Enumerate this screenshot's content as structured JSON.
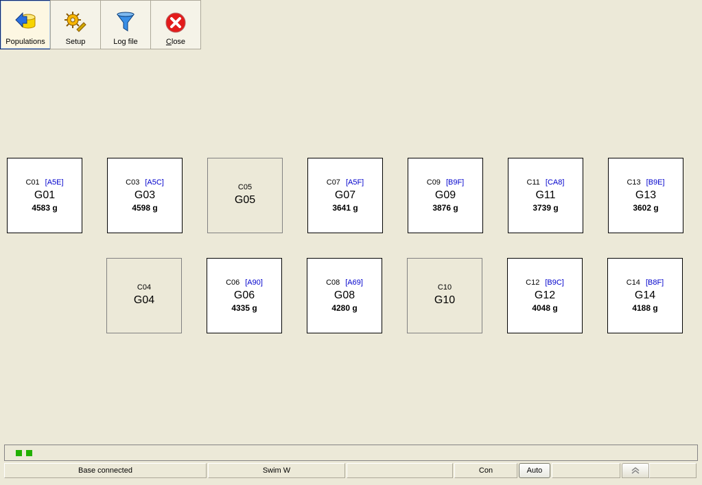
{
  "toolbar": {
    "populations": {
      "label": "Populations",
      "icon": "db-arrow"
    },
    "setup": {
      "label": "Setup",
      "icon": "gears"
    },
    "logfile": {
      "label": "Log file",
      "icon": "funnel"
    },
    "close": {
      "label": "Close",
      "mnemonic": "C",
      "icon": "close-x"
    }
  },
  "tiles": {
    "row1": [
      {
        "code": "C01",
        "hex": "[A5E]",
        "name": "G01",
        "weight": "4583 g",
        "active": true
      },
      {
        "code": "C03",
        "hex": "[A5C]",
        "name": "G03",
        "weight": "4598 g",
        "active": true
      },
      {
        "code": "C05",
        "hex": "",
        "name": "G05",
        "weight": "",
        "active": false
      },
      {
        "code": "C07",
        "hex": "[A5F]",
        "name": "G07",
        "weight": "3641 g",
        "active": true
      },
      {
        "code": "C09",
        "hex": "[B9F]",
        "name": "G09",
        "weight": "3876 g",
        "active": true
      },
      {
        "code": "C11",
        "hex": "[CA8]",
        "name": "G11",
        "weight": "3739 g",
        "active": true
      },
      {
        "code": "C13",
        "hex": "[B9E]",
        "name": "G13",
        "weight": "3602 g",
        "active": true
      }
    ],
    "row2": [
      {
        "code": "C04",
        "hex": "",
        "name": "G04",
        "weight": "",
        "active": false
      },
      {
        "code": "C06",
        "hex": "[A90]",
        "name": "G06",
        "weight": "4335 g",
        "active": true
      },
      {
        "code": "C08",
        "hex": "[A69]",
        "name": "G08",
        "weight": "4280 g",
        "active": true
      },
      {
        "code": "C10",
        "hex": "",
        "name": "G10",
        "weight": "",
        "active": false
      },
      {
        "code": "C12",
        "hex": "[B9C]",
        "name": "G12",
        "weight": "4048 g",
        "active": true
      },
      {
        "code": "C14",
        "hex": "[B8F]",
        "name": "G14",
        "weight": "4188 g",
        "active": true
      }
    ]
  },
  "status": {
    "base": "Base connected",
    "swim": "Swim W",
    "con": "Con",
    "auto": "Auto"
  }
}
